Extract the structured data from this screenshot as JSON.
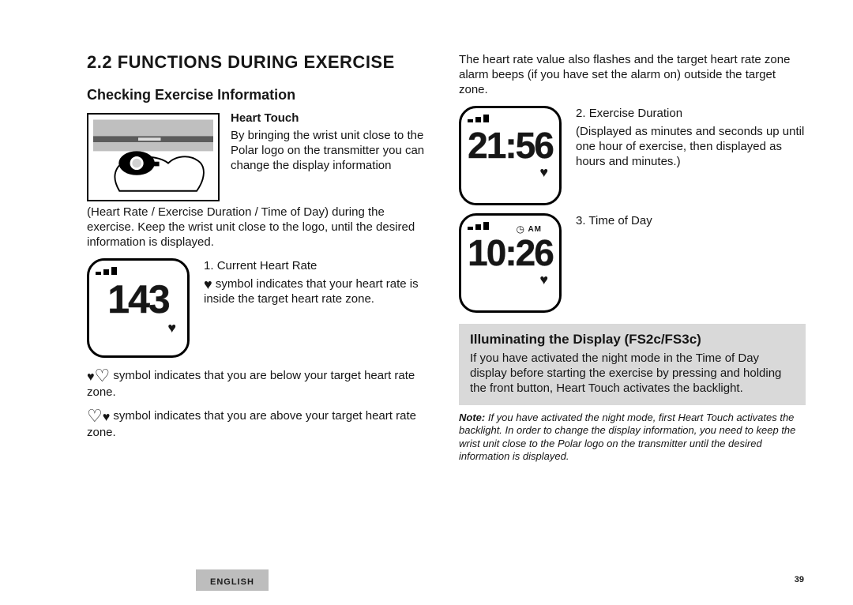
{
  "page": {
    "language_tab": "ENGLISH",
    "number": "39"
  },
  "left": {
    "heading": "2.2  FUNCTIONS DURING EXERCISE",
    "sub": "Checking Exercise Information",
    "ht_title": "Heart Touch",
    "ht_para_a": "By bringing the wrist unit close to the Polar logo on the transmitter you can change the display information",
    "ht_para_b": "(Heart Rate / Exercise Duration / Time of Day) during the exercise. Keep the wrist unit close to the logo, until the desired information is displayed.",
    "item1": "Current Heart Rate",
    "item1_sub": " symbol indicates that your heart rate is inside the target heart rate zone.",
    "below": " symbol indicates that you are below your target heart rate zone.",
    "above": " symbol indicates that you are above your target heart rate zone.",
    "watch1": "143"
  },
  "right": {
    "top": "The heart rate value also flashes and the target heart rate zone alarm beeps (if you have set the alarm on) outside the target zone.",
    "item2_a": "Exercise Duration",
    "item2_b": "(Displayed as minutes and seconds up until one hour of exercise, then displayed as hours and minutes.)",
    "item3": "Time of Day",
    "watch2": "21:56",
    "watch3": "10:26",
    "watch3_ampm": "AM",
    "box_title": "Illuminating the Display (FS2c/FS3c)",
    "box_body": "If you have activated the night mode in the Time of Day display before starting the exercise by pressing and holding the front button, Heart Touch activates the backlight.",
    "note_label": "Note:",
    "note_body": " If you have activated the night mode, first Heart Touch activates the backlight. In order to change the display information, you need to keep the wrist unit close to the Polar logo on the transmitter until the desired information is displayed."
  }
}
